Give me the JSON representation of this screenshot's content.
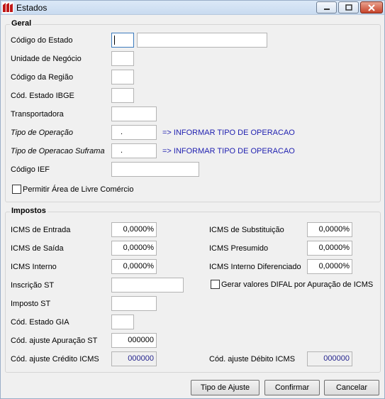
{
  "window": {
    "title": "Estados"
  },
  "geral": {
    "title": "Geral",
    "codigo_estado_label": "Código do Estado",
    "codigo_estado_value": "",
    "codigo_estado_desc_value": "",
    "unidade_negocio_label": "Unidade de Negócio",
    "codigo_regiao_label": "Código da Região",
    "cod_ibge_label": "Cód. Estado IBGE",
    "transportadora_label": "Transportadora",
    "tipo_operacao_label": "Tipo de Operação",
    "tipo_operacao_value": ".",
    "tipo_operacao_hint": "=> INFORMAR TIPO DE OPERACAO",
    "tipo_operacao_suframa_label": "Tipo de Operacao Suframa",
    "tipo_operacao_suframa_value": ".",
    "tipo_operacao_suframa_hint": "=> INFORMAR TIPO DE OPERACAO",
    "codigo_ief_label": "Código IEF",
    "livre_comercio_label": "Permitir Área de Livre Comércio"
  },
  "impostos": {
    "title": "Impostos",
    "icms_entrada_label": "ICMS de Entrada",
    "icms_entrada_value": "0,0000%",
    "icms_saida_label": "ICMS de Saída",
    "icms_saida_value": "0,0000%",
    "icms_interno_label": "ICMS Interno",
    "icms_interno_value": "0,0000%",
    "inscricao_st_label": "Inscrição ST",
    "imposto_st_label": "Imposto ST",
    "cod_estado_gia_label": "Cód. Estado GIA",
    "cod_ajuste_apuracao_label": "Cód. ajuste Apuração ST",
    "cod_ajuste_apuracao_value": "000000",
    "cod_ajuste_credito_label": "Cód. ajuste Crédito ICMS",
    "cod_ajuste_credito_value": "000000",
    "icms_substituicao_label": "ICMS de Substituição",
    "icms_substituicao_value": "0,0000%",
    "icms_presumido_label": "ICMS Presumido",
    "icms_presumido_value": "0,0000%",
    "icms_interno_dif_label": "ICMS Interno Diferenciado",
    "icms_interno_dif_value": "0,0000%",
    "difal_label": "Gerar valores DIFAL por Apuração de ICMS",
    "cod_ajuste_debito_label": "Cód. ajuste Débito ICMS",
    "cod_ajuste_debito_value": "000000"
  },
  "buttons": {
    "tipo_ajuste": "Tipo de Ajuste",
    "confirmar": "Confirmar",
    "cancelar": "Cancelar"
  },
  "colors": {
    "link": "#1f1fb0",
    "readonly_text": "#1f1f8a",
    "focus_border": "#3d7bbd"
  },
  "icons": {
    "app": "app-logo-icon",
    "minimize": "minimize-icon",
    "maximize": "maximize-icon",
    "close": "close-icon",
    "checkbox": "checkbox-icon"
  }
}
